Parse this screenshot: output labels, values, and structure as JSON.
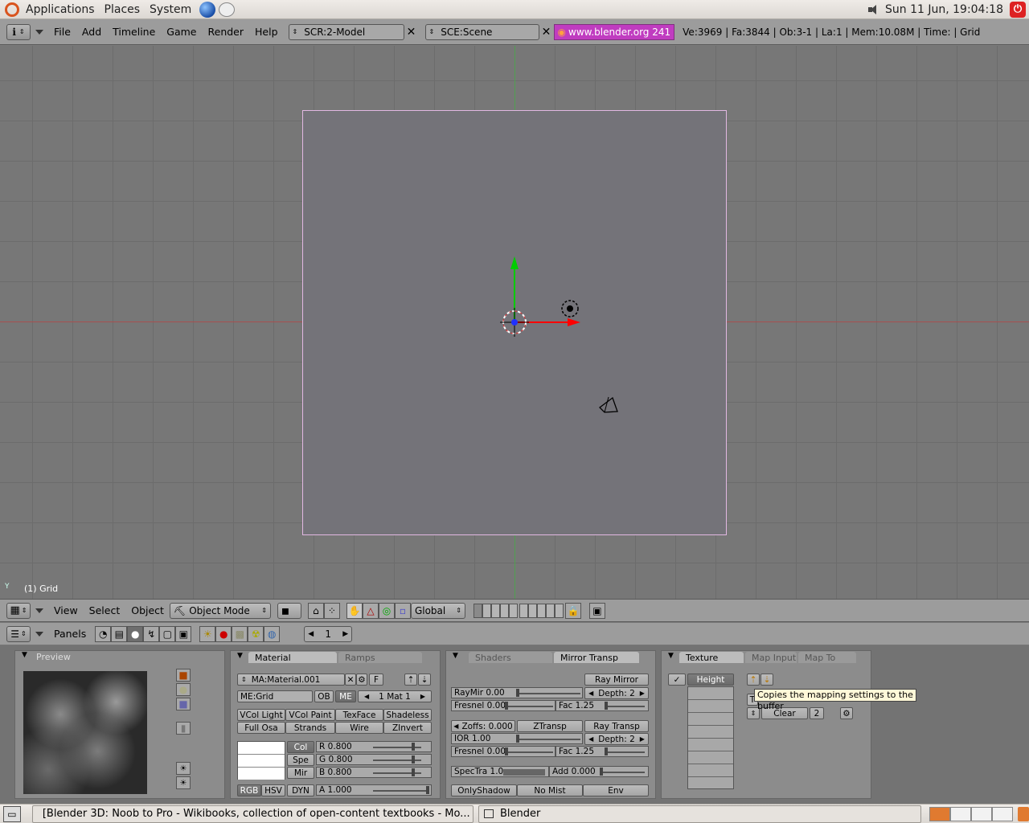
{
  "gnome_top": {
    "menus": [
      "Applications",
      "Places",
      "System"
    ],
    "clock": "Sun 11 Jun, 19:04:18"
  },
  "blender_header": {
    "menus": [
      "File",
      "Add",
      "Timeline",
      "Game",
      "Render",
      "Help"
    ],
    "screen": "SCR:2-Model",
    "scene": "SCE:Scene",
    "url": "www.blender.org 241",
    "stats": "Ve:3969 | Fa:3844 | Ob:3-1 | La:1 | Mem:10.08M | Time: | Grid"
  },
  "viewport": {
    "label": "(1) Grid",
    "axis_label": "Y"
  },
  "view3d_header": {
    "menus": [
      "View",
      "Select",
      "Object"
    ],
    "mode": "Object Mode",
    "orientation": "Global"
  },
  "buttons_header": {
    "panels_label": "Panels",
    "frame": "1"
  },
  "preview_panel": {
    "title": "Preview"
  },
  "material_panel": {
    "tabs": [
      "Material",
      "Ramps"
    ],
    "material_name": "MA:Material.001",
    "f_label": "F",
    "mesh_name": "ME:Grid",
    "ob_label": "OB",
    "me_label": "ME",
    "mat_index": "1 Mat 1",
    "toggles_row1": [
      "VCol Light",
      "VCol Paint",
      "TexFace",
      "Shadeless"
    ],
    "toggles_row2": [
      "Full Osa",
      "Strands",
      "Wire",
      "ZInvert"
    ],
    "color_tabs": [
      "Col",
      "Spe",
      "Mir"
    ],
    "r": "R 0.800",
    "g": "G 0.800",
    "b": "B 0.800",
    "modes": [
      "RGB",
      "HSV",
      "DYN"
    ],
    "alpha": "A 1.000"
  },
  "shaders_panel": {
    "tabs": [
      "Shaders",
      "Mirror Transp"
    ],
    "ray_mirror": "Ray Mirror",
    "raymir": "RayMir 0.00",
    "depth1": "Depth: 2",
    "fresnel1": "Fresnel 0.00",
    "fac1": "Fac 1.25",
    "zoffs": "Zoffs: 0.000",
    "ztransp": "ZTransp",
    "ray_transp": "Ray Transp",
    "ior": "IOR 1.00",
    "depth2": "Depth: 2",
    "fresnel2": "Fresnel 0.00",
    "fac2": "Fac 1.25",
    "spectra": "SpecTra 1.0",
    "add": "Add 0.000",
    "onlyshadow": "OnlyShadow",
    "nomist": "No Mist",
    "env": "Env"
  },
  "texture_panel": {
    "tabs": [
      "Texture",
      "Map Input",
      "Map To"
    ],
    "channel": "Height",
    "tooltip": "Copies the mapping settings to the buffer",
    "clear": "Clear",
    "users": "2",
    "tex_prefix": "T"
  },
  "gnome_bottom": {
    "task1": "[Blender 3D: Noob to Pro - Wikibooks, collection of open-content textbooks - Mo...",
    "task2": "Blender"
  },
  "colors": {
    "grid_plane_outline": "#e2b8e2",
    "x_axis": "#ff0000",
    "y_axis": "#00cc00",
    "url_badge": "#c03cc0"
  }
}
